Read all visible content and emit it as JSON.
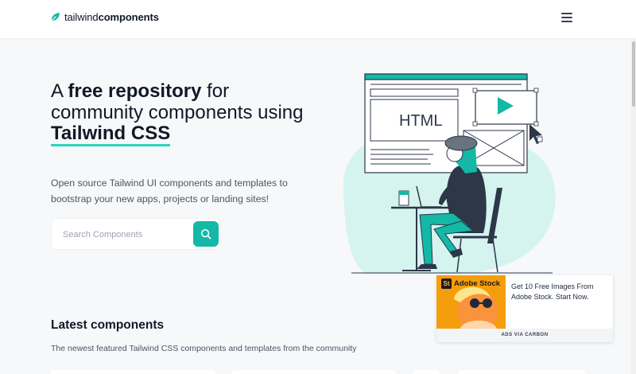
{
  "header": {
    "logo_light": "tailwind",
    "logo_bold": "components",
    "menu_icon": "hamburger-menu-icon"
  },
  "hero": {
    "title_pre": "A ",
    "title_bold": "free repository",
    "title_mid": " for community components using ",
    "title_highlight": "Tailwind CSS",
    "subtitle": "Open source Tailwind UI components and templates to bootstrap your new apps, projects or landing sites!",
    "illustration_code_label": "HTML"
  },
  "search": {
    "placeholder": "Search Components",
    "value": "",
    "button_icon": "search-icon"
  },
  "ad": {
    "brand": "Adobe Stock",
    "badge": "St",
    "text": "Get 10 Free Images From Adobe Stock. Start Now.",
    "via": "ADS VIA CARBON"
  },
  "latest": {
    "title": "Latest components",
    "subtitle": "The newest featured Tailwind CSS components and templates from the community"
  },
  "colors": {
    "accent": "#14b8a6",
    "highlight_underline": "#2dd4bf",
    "illustration_blob": "#d5f3ef",
    "background": "#f7f8f9"
  }
}
